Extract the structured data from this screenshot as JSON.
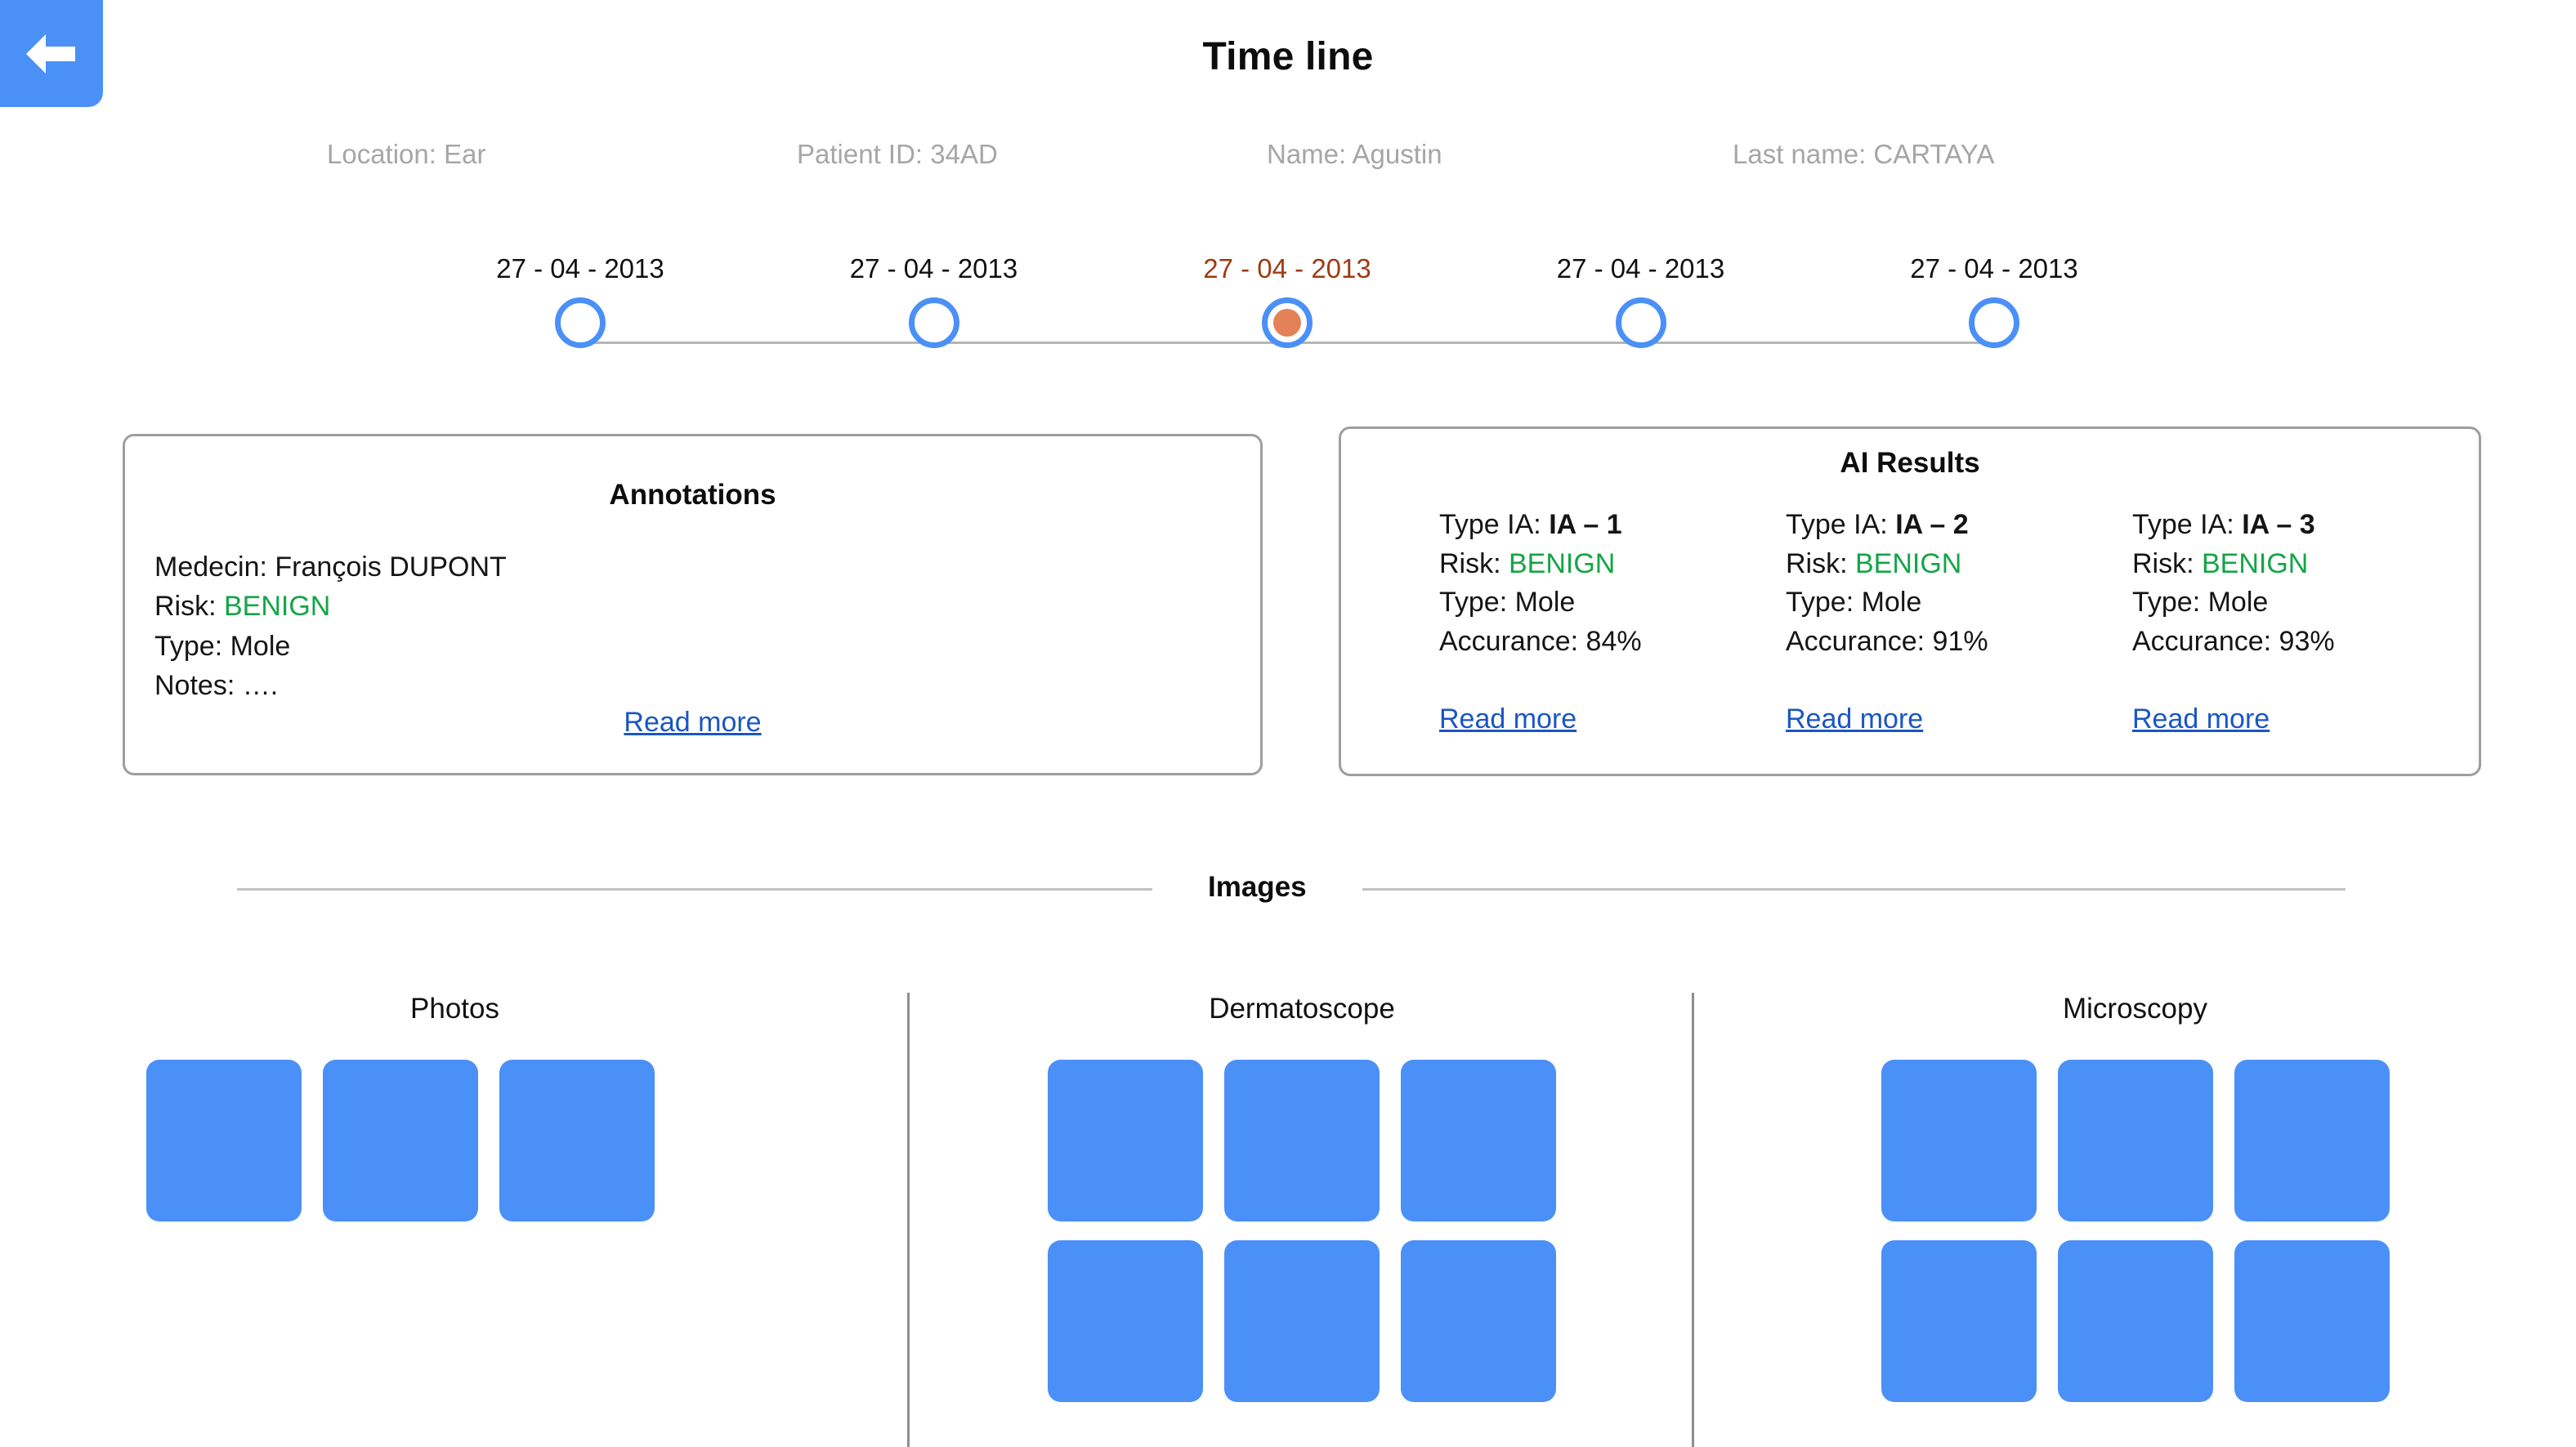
{
  "header": {
    "title": "Time line",
    "back_button_label": "Back",
    "back_icon": "arrow-left-icon"
  },
  "patient": {
    "fields": [
      "Location: Ear",
      "Patient ID: 34AD",
      "Name: Agustin",
      "Last name: CARTAYA"
    ]
  },
  "timeline": {
    "active_index": 2,
    "active_color": "#9f3a12",
    "node_color": "#4a90f7",
    "active_fill_color": "#e38159",
    "nodes": [
      {
        "date": "27 - 04 - 2013"
      },
      {
        "date": "27 - 04 - 2013"
      },
      {
        "date": "27 - 04 - 2013"
      },
      {
        "date": "27 - 04 - 2013"
      },
      {
        "date": "27 - 04 - 2013"
      }
    ]
  },
  "annotations": {
    "title": "Annotations",
    "medecin_label": "Medecin: François DUPONT",
    "risk_label": "Risk: ",
    "risk_value": "BENIGN",
    "risk_color": "#14a546",
    "type_label": "Type: Mole",
    "notes_label": "Notes: ….",
    "read_more": "Read more"
  },
  "ai_results": {
    "title": "AI Results",
    "columns": [
      {
        "type_label": "Type IA: ",
        "type_value": "IA – 1",
        "risk_label": "Risk: ",
        "risk_value": "BENIGN",
        "kind_label": "Type: Mole",
        "accuracy_label": "Accurance: 84%",
        "read_more": "Read more"
      },
      {
        "type_label": "Type IA: ",
        "type_value": "IA – 2",
        "risk_label": "Risk: ",
        "risk_value": "BENIGN",
        "kind_label": "Type: Mole",
        "accuracy_label": "Accurance: 91%",
        "read_more": "Read more"
      },
      {
        "type_label": "Type IA: ",
        "type_value": "IA – 3",
        "risk_label": "Risk: ",
        "risk_value": "BENIGN",
        "kind_label": "Type: Mole",
        "accuracy_label": "Accurance: 93%",
        "read_more": "Read more"
      }
    ]
  },
  "images_section": {
    "label": "Images",
    "groups": [
      {
        "title": "Photos",
        "tile_count": 3,
        "tile_color": "#4a90f7"
      },
      {
        "title": "Dermatoscope",
        "tile_count": 6,
        "tile_color": "#4a90f7"
      },
      {
        "title": "Microscopy",
        "tile_count": 6,
        "tile_color": "#4a90f7"
      }
    ]
  }
}
